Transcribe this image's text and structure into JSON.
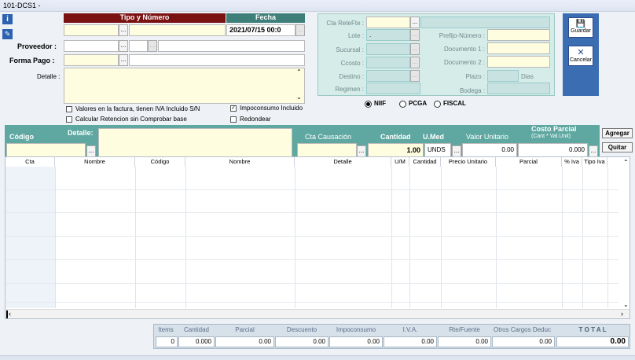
{
  "window": {
    "title": "101-DCS1 -"
  },
  "header": {
    "tipo_numero_label": "Tipo y Número",
    "fecha_label": "Fecha",
    "fecha_value": "2021/07/15 00:0",
    "proveedor_label": "Proveedor :",
    "forma_pago_label": "Forma Pago :",
    "detalle_label": "Detalle :"
  },
  "options": {
    "iva_incluido": "Valores en la factura, tienen  IVA Incluido S/N",
    "impoconsumo": "Impoconsumo Incluido",
    "calc_retencion": "Calcular Retencion sin Comprobar base",
    "redondear": "Redondear"
  },
  "refs": {
    "cta_retefte": "Cta ReteFte :",
    "lote": "Lote :",
    "lote_value": ".",
    "sucursal": "Sucursal :",
    "ccosto": "Ccosto :",
    "destino": "Destino :",
    "regimen": "Regimen :",
    "prefijo_numero": "Prefijo-Número :",
    "documento1": "Documento 1 :",
    "documento2": "Documento 2 :",
    "plazo": "Plazo :",
    "dias": "Dias",
    "bodega": "Bodega :"
  },
  "actions": {
    "guardar": "Guardar",
    "cancelar": "Cancelar",
    "agregar": "Agregar",
    "quitar": "Quitar"
  },
  "norma": {
    "niif": "NIIF",
    "pcga": "PCGA",
    "fiscal": "FISCAL"
  },
  "detail_entry": {
    "codigo_label": "Código",
    "detalle_label": "Detalle:",
    "cta_causacion_label": "Cta Causación",
    "cantidad_label": "Cantidad",
    "umed_label": "U.Med",
    "valor_unitario_label": "Valor Unitario",
    "costo_parcial_label": "Costo Parcial",
    "costo_parcial_sub": "(Cant * Val.Unit)",
    "cantidad_value": "1.00",
    "umed_value": "UNDS",
    "valor_unitario_value": "0.00",
    "costo_parcial_value": "0.000"
  },
  "grid": {
    "columns": [
      "Cta",
      "Nombre",
      "Código",
      "Nombre",
      "Detalle",
      "U/M",
      "Cantidad",
      "Precio Unitario",
      "Parcial",
      "% Iva",
      "Tipo Iva"
    ]
  },
  "totals": {
    "headers": [
      "Items",
      "Cantidad",
      "Parcial",
      "Descuento",
      "Impoconsumo",
      "I.V.A.",
      "Rte/Fuente",
      "Otros Cargos Deduc",
      "T O T A L"
    ],
    "values": [
      "0",
      "0.000",
      "0.00",
      "0.00",
      "0.00",
      "0.00",
      "0.00",
      "0.00",
      "0.00"
    ]
  },
  "colors": {
    "accent_red": "#7b1212",
    "accent_teal": "#3f7f7a",
    "panel_teal": "#5fa8a2",
    "input_yellow": "#fffde0",
    "button_blue": "#3b6db2"
  }
}
